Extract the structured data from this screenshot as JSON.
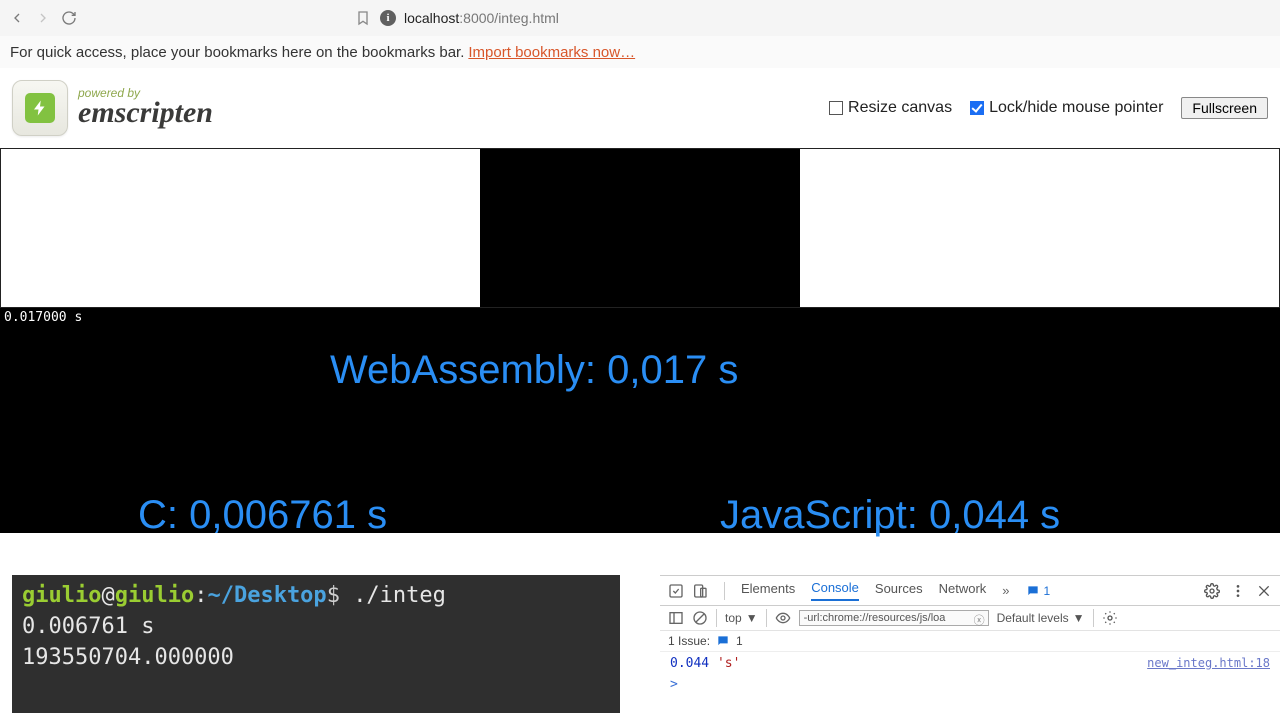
{
  "browser": {
    "url_host": "localhost",
    "url_port_path": ":8000/integ.html",
    "bookmarks_tip": "For quick access, place your bookmarks here on the bookmarks bar.",
    "import_link": "Import bookmarks now…"
  },
  "header": {
    "powered_by": "powered by",
    "brand": "emscripten",
    "resize_label": "Resize canvas",
    "lock_label": "Lock/hide mouse pointer",
    "fullscreen": "Fullscreen",
    "resize_checked": false,
    "lock_checked": true
  },
  "output": {
    "line1": "0.017000 s"
  },
  "overlays": {
    "wasm": "WebAssembly: 0,017 s",
    "c": "C: 0,006761 s",
    "js": "JavaScript: 0,044 s"
  },
  "terminal": {
    "user": "giulio",
    "at": "@",
    "host": "giulio",
    "colon": ":",
    "path": "~/Desktop",
    "prompt": "$",
    "cmd": "./integ",
    "out1": "0.006761 s",
    "out2": "193550704.000000"
  },
  "devtools": {
    "tabs": {
      "elements": "Elements",
      "console": "Console",
      "sources": "Sources",
      "network": "Network"
    },
    "more": "»",
    "msg_count": "1",
    "top": "top",
    "filter_value": "-url:chrome://resources/js/loa",
    "levels": "Default levels",
    "issue_prefix": "1 Issue:",
    "issue_count": "1",
    "console_num": "0.044",
    "console_str": "'s'",
    "source_link": "new_integ.html:18",
    "prompt": ">"
  }
}
